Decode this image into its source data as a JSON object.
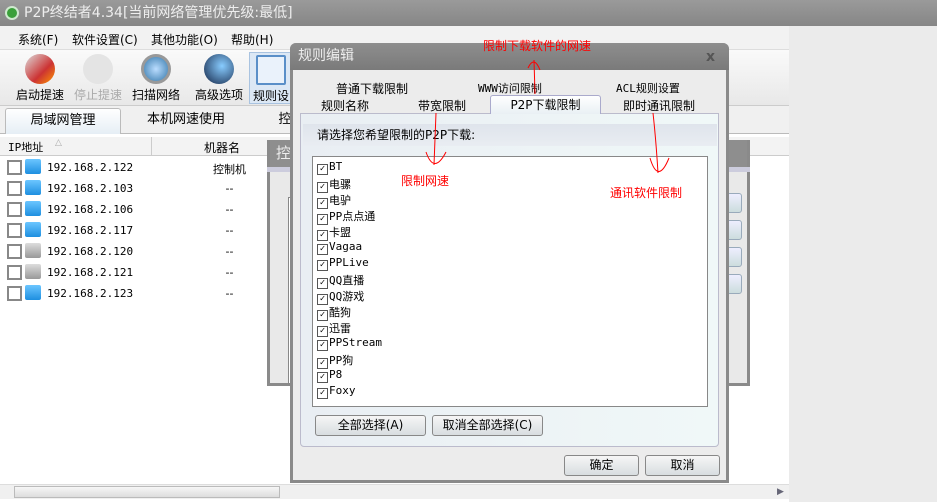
{
  "window": {
    "title": "P2P终结者4.34[当前网络管理优先级:最低]"
  },
  "menu": [
    "系统(F)",
    "软件设置(C)",
    "其他功能(O)",
    "帮助(H)"
  ],
  "toolbar": [
    {
      "label": "启动提速",
      "icon": "rocket-icon"
    },
    {
      "label": "停止提速",
      "icon": "stop-icon",
      "disabled": true
    },
    {
      "label": "扫描网络",
      "icon": "magnifier-icon"
    },
    {
      "label": "高级选项",
      "icon": "globe-gear-icon"
    },
    {
      "label": "规则设",
      "icon": "rules-icon"
    }
  ],
  "main_tabs": [
    "局域网管理",
    "本机网速使用",
    "控"
  ],
  "list": {
    "headers": [
      "IP地址",
      "机器名"
    ],
    "rows": [
      {
        "ip": "192.168.2.122",
        "name": "控制机",
        "online": true
      },
      {
        "ip": "192.168.2.103",
        "name": "--",
        "online": true
      },
      {
        "ip": "192.168.2.106",
        "name": "--",
        "online": true
      },
      {
        "ip": "192.168.2.117",
        "name": "--",
        "online": true
      },
      {
        "ip": "192.168.2.120",
        "name": "--",
        "online": false
      },
      {
        "ip": "192.168.2.121",
        "name": "--",
        "online": false
      },
      {
        "ip": "192.168.2.123",
        "name": "--",
        "online": true
      }
    ]
  },
  "bg_dialog": {
    "title": "控"
  },
  "dialog": {
    "title": "规则编辑",
    "close": "x",
    "tabs_row1": [
      "普通下载限制",
      "WWW访问限制",
      "ACL规则设置"
    ],
    "tabs_row2": [
      "规则名称",
      "带宽限制",
      "P2P下载限制",
      "即时通讯限制"
    ],
    "prompt": "请选择您希望限制的P2P下载:",
    "items": [
      "BT",
      "电骡",
      "电驴",
      "PP点点通",
      "卡盟",
      "Vagaa",
      "PPLive",
      "QQ直播",
      "QQ游戏",
      "酷狗",
      "迅雷",
      "PPStream",
      "PP狗",
      "P8",
      "Foxy"
    ],
    "select_all": "全部选择(A)",
    "deselect_all": "取消全部选择(C)",
    "ok": "确定",
    "cancel": "取消"
  },
  "annotations": [
    "限制下载软件的网速",
    "限制网速",
    "通讯软件限制"
  ],
  "colors": {
    "annotation": "#ff0000"
  }
}
